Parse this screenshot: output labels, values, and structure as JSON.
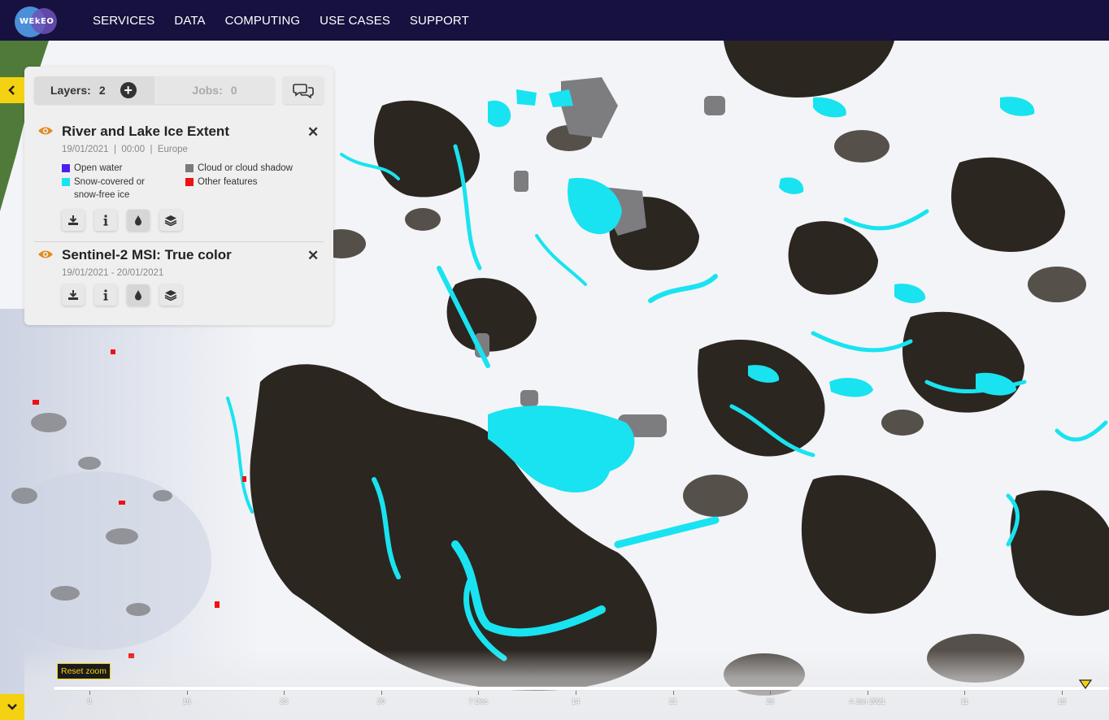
{
  "nav": {
    "logo_text": "WEkEO",
    "items": [
      "SERVICES",
      "DATA",
      "COMPUTING",
      "USE CASES",
      "SUPPORT"
    ]
  },
  "panel": {
    "layers_label": "Layers:",
    "layers_count": "2",
    "jobs_label": "Jobs:",
    "jobs_count": "0",
    "layers": [
      {
        "title": "River and Lake Ice Extent",
        "meta": "19/01/2021  |  00:00  |  Europe",
        "legend": [
          {
            "label": "Open water",
            "color": "#4b1ff0"
          },
          {
            "label": "Cloud or cloud shadow",
            "color": "#7a7a7a"
          },
          {
            "label": "Snow-covered or snow-free ice",
            "color": "#19e3f0"
          },
          {
            "label": "Other features",
            "color": "#ee1111"
          }
        ]
      },
      {
        "title": "Sentinel-2 MSI: True color",
        "meta": "19/01/2021 - 20/01/2021"
      }
    ]
  },
  "timeline": {
    "reset_zoom": "Reset zoom",
    "labels": [
      "9",
      "16",
      "23",
      "30",
      "7 Dec",
      "14",
      "21",
      "28",
      "4 Jan 2021",
      "11",
      "18"
    ]
  },
  "colors": {
    "navbar": "#16113f",
    "accent": "#f5d211",
    "eye": "#e08a1e",
    "ice": "#19e3f0",
    "land": "#2c2620"
  }
}
